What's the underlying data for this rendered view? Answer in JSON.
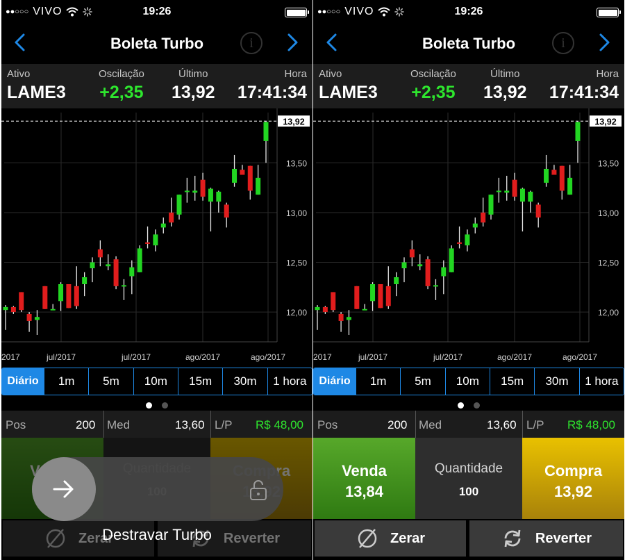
{
  "status_bar": {
    "carrier": "VIVO",
    "time": "19:26"
  },
  "nav": {
    "title": "Boleta Turbo"
  },
  "quote": {
    "ativo_label": "Ativo",
    "ativo": "LAME3",
    "osc_label": "Oscilação",
    "osc": "+2,35",
    "ultimo_label": "Último",
    "ultimo": "13,92",
    "hora_label": "Hora",
    "hora": "17:41:34"
  },
  "chart_data": {
    "type": "candlestick",
    "last_price_label": "13,92",
    "y_ticks": [
      "13,50",
      "13,00",
      "12,50",
      "12,00"
    ],
    "x_ticks": [
      "2017",
      "jul/2017",
      "jul/2017",
      "ago/2017",
      "ago/2017"
    ],
    "ylim": [
      11.7,
      13.95
    ],
    "candles": [
      {
        "o": 12.05,
        "h": 12.07,
        "l": 11.82,
        "c": 12.02,
        "dir": "up"
      },
      {
        "o": 12.05,
        "h": 12.06,
        "l": 11.98,
        "c": 12.0,
        "dir": "down"
      },
      {
        "o": 12.2,
        "h": 12.2,
        "l": 12.0,
        "c": 12.02,
        "dir": "down"
      },
      {
        "o": 11.98,
        "h": 12.0,
        "l": 11.8,
        "c": 11.91,
        "dir": "down"
      },
      {
        "o": 11.92,
        "h": 12.02,
        "l": 11.77,
        "c": 11.95,
        "dir": "up"
      },
      {
        "o": 12.03,
        "h": 12.26,
        "l": 12.03,
        "c": 12.26,
        "dir": "down"
      },
      {
        "o": 12.02,
        "h": 12.08,
        "l": 12.02,
        "c": 12.03,
        "dir": "up"
      },
      {
        "o": 12.11,
        "h": 12.3,
        "l": 12.01,
        "c": 12.28,
        "dir": "up"
      },
      {
        "o": 12.28,
        "h": 12.28,
        "l": 12.04,
        "c": 12.04,
        "dir": "down"
      },
      {
        "o": 12.26,
        "h": 12.46,
        "l": 12.03,
        "c": 12.06,
        "dir": "down"
      },
      {
        "o": 12.28,
        "h": 12.4,
        "l": 12.16,
        "c": 12.35,
        "dir": "up"
      },
      {
        "o": 12.44,
        "h": 12.55,
        "l": 12.3,
        "c": 12.5,
        "dir": "up"
      },
      {
        "o": 12.55,
        "h": 12.72,
        "l": 12.46,
        "c": 12.63,
        "dir": "down"
      },
      {
        "o": 12.48,
        "h": 12.58,
        "l": 12.42,
        "c": 12.46,
        "dir": "up"
      },
      {
        "o": 12.53,
        "h": 12.56,
        "l": 12.23,
        "c": 12.26,
        "dir": "down"
      },
      {
        "o": 12.26,
        "h": 12.33,
        "l": 12.12,
        "c": 12.27,
        "dir": "up"
      },
      {
        "o": 12.36,
        "h": 12.52,
        "l": 12.18,
        "c": 12.45,
        "dir": "up"
      },
      {
        "o": 12.4,
        "h": 12.67,
        "l": 12.4,
        "c": 12.64,
        "dir": "up"
      },
      {
        "o": 12.7,
        "h": 12.86,
        "l": 12.64,
        "c": 12.7,
        "dir": "down"
      },
      {
        "o": 12.67,
        "h": 12.83,
        "l": 12.61,
        "c": 12.78,
        "dir": "up"
      },
      {
        "o": 12.85,
        "h": 12.95,
        "l": 12.79,
        "c": 12.89,
        "dir": "up"
      },
      {
        "o": 13.0,
        "h": 13.15,
        "l": 12.86,
        "c": 12.9,
        "dir": "down"
      },
      {
        "o": 12.98,
        "h": 13.18,
        "l": 12.93,
        "c": 13.18,
        "dir": "up"
      },
      {
        "o": 13.22,
        "h": 13.35,
        "l": 13.1,
        "c": 13.22,
        "dir": "up"
      },
      {
        "o": 13.2,
        "h": 13.37,
        "l": 13.12,
        "c": 13.22,
        "dir": "up"
      },
      {
        "o": 13.33,
        "h": 13.4,
        "l": 13.12,
        "c": 13.16,
        "dir": "down"
      },
      {
        "o": 13.24,
        "h": 13.25,
        "l": 12.81,
        "c": 13.11,
        "dir": "up"
      },
      {
        "o": 13.21,
        "h": 13.22,
        "l": 13.0,
        "c": 13.11,
        "dir": "up"
      },
      {
        "o": 13.08,
        "h": 13.1,
        "l": 12.85,
        "c": 12.95,
        "dir": "down"
      },
      {
        "o": 13.3,
        "h": 13.58,
        "l": 13.26,
        "c": 13.44,
        "dir": "up"
      },
      {
        "o": 13.43,
        "h": 13.48,
        "l": 13.39,
        "c": 13.38,
        "dir": "down"
      },
      {
        "o": 13.47,
        "h": 13.47,
        "l": 13.13,
        "c": 13.22,
        "dir": "down"
      },
      {
        "o": 13.35,
        "h": 13.48,
        "l": 13.18,
        "c": 13.18,
        "dir": "up"
      },
      {
        "o": 13.72,
        "h": 13.92,
        "l": 13.5,
        "c": 13.91,
        "dir": "up"
      }
    ]
  },
  "periods": [
    "Diário",
    "1m",
    "5m",
    "10m",
    "15m",
    "30m",
    "1 hora"
  ],
  "position": {
    "pos_label": "Pos",
    "pos": "200",
    "med_label": "Med",
    "med": "13,60",
    "lp_label": "L/P",
    "lp": "R$ 48,00"
  },
  "trade": {
    "venda_label": "Venda",
    "venda_price": "13,84",
    "qtd_label": "Quantidade",
    "qtd": "100",
    "compra_label": "Compra",
    "compra_price": "13,92"
  },
  "actions": {
    "zerar": "Zerar",
    "reverter": "Reverter"
  },
  "overlay": {
    "slider_text": "Destravar Turbo"
  },
  "colors": {
    "up": "#22d622",
    "down": "#e11d1d",
    "accent": "#1e88e5",
    "positive": "#2ee62e"
  }
}
